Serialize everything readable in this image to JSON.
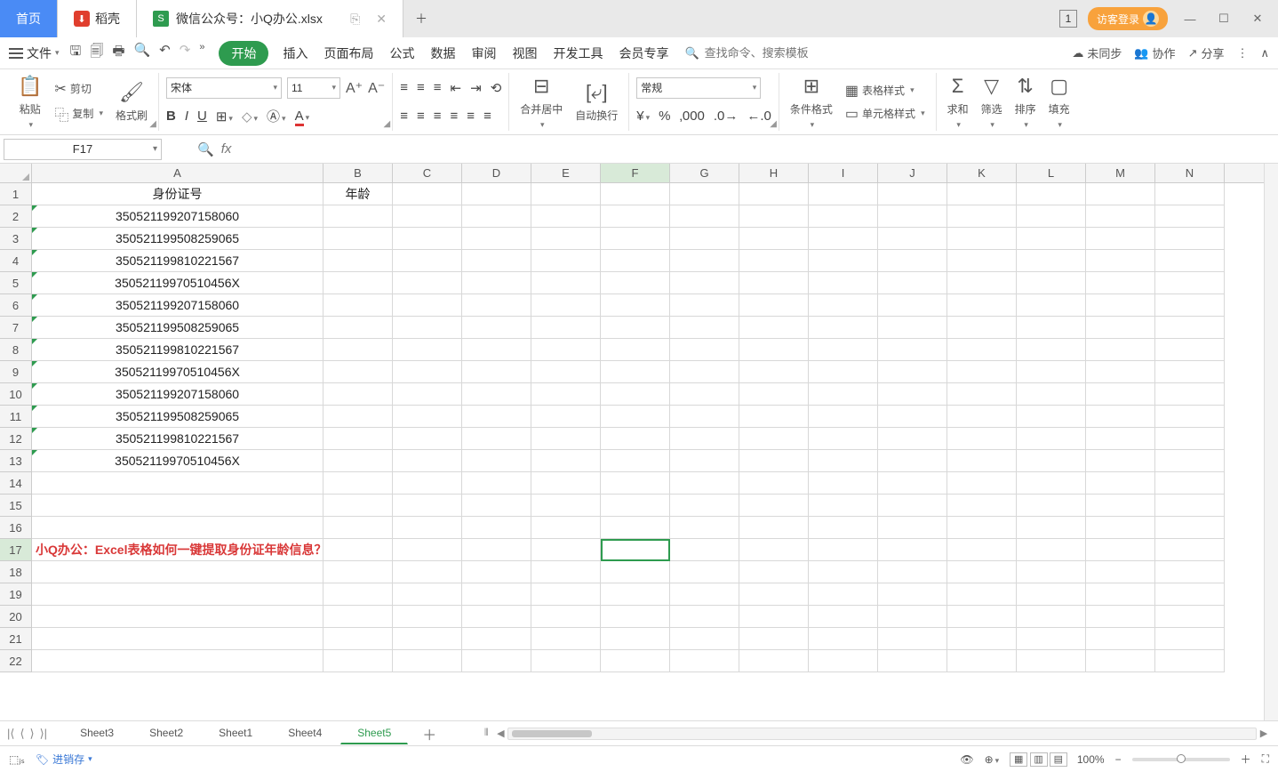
{
  "title_tabs": {
    "home": "首页",
    "doke": "稻壳",
    "filename": "微信公众号：小Q办公.xlsx",
    "num_box": "1",
    "guest_login": "访客登录"
  },
  "menu": {
    "file_label": "文件",
    "items": [
      "开始",
      "插入",
      "页面布局",
      "公式",
      "数据",
      "审阅",
      "视图",
      "开发工具",
      "会员专享"
    ],
    "search_placeholder": "查找命令、搜索模板",
    "right": {
      "unsync": "未同步",
      "collab": "协作",
      "share": "分享"
    }
  },
  "ribbon": {
    "paste": "粘贴",
    "cut": "剪切",
    "copy": "复制",
    "format_painter": "格式刷",
    "font": "宋体",
    "size": "11",
    "merge_center": "合并居中",
    "auto_wrap": "自动换行",
    "number_format": "常规",
    "cond_format": "条件格式",
    "table_style": "表格样式",
    "cell_style": "单元格样式",
    "sum": "求和",
    "filter": "筛选",
    "sort": "排序",
    "fill": "填充"
  },
  "namebox": "F17",
  "columns": [
    "A",
    "B",
    "C",
    "D",
    "E",
    "F",
    "G",
    "H",
    "I",
    "J",
    "K",
    "L",
    "M",
    "N"
  ],
  "col_widths": {
    "A": 328,
    "other": 78
  },
  "row_count": 22,
  "active": {
    "row": 17,
    "col": "F"
  },
  "data": {
    "A1": "身份证号",
    "B1": "年龄",
    "A2": "350521199207158060",
    "A3": "350521199508259065",
    "A4": "350521199810221567",
    "A5": "35052119970510456X",
    "A6": "350521199207158060",
    "A7": "350521199508259065",
    "A8": "350521199810221567",
    "A9": "35052119970510456X",
    "A10": "350521199207158060",
    "A11": "350521199508259065",
    "A12": "350521199810221567",
    "A13": "35052119970510456X",
    "A17": "小Q办公：Excel表格如何一键提取身份证年龄信息？"
  },
  "text_marked_rows": [
    2,
    3,
    4,
    5,
    6,
    7,
    8,
    9,
    10,
    11,
    12,
    13
  ],
  "red_rows": [
    17
  ],
  "sheets": [
    "Sheet3",
    "Sheet2",
    "Sheet1",
    "Sheet4",
    "Sheet5"
  ],
  "active_sheet": "Sheet5",
  "status": {
    "jxc": "进销存",
    "zoom": "100%"
  }
}
